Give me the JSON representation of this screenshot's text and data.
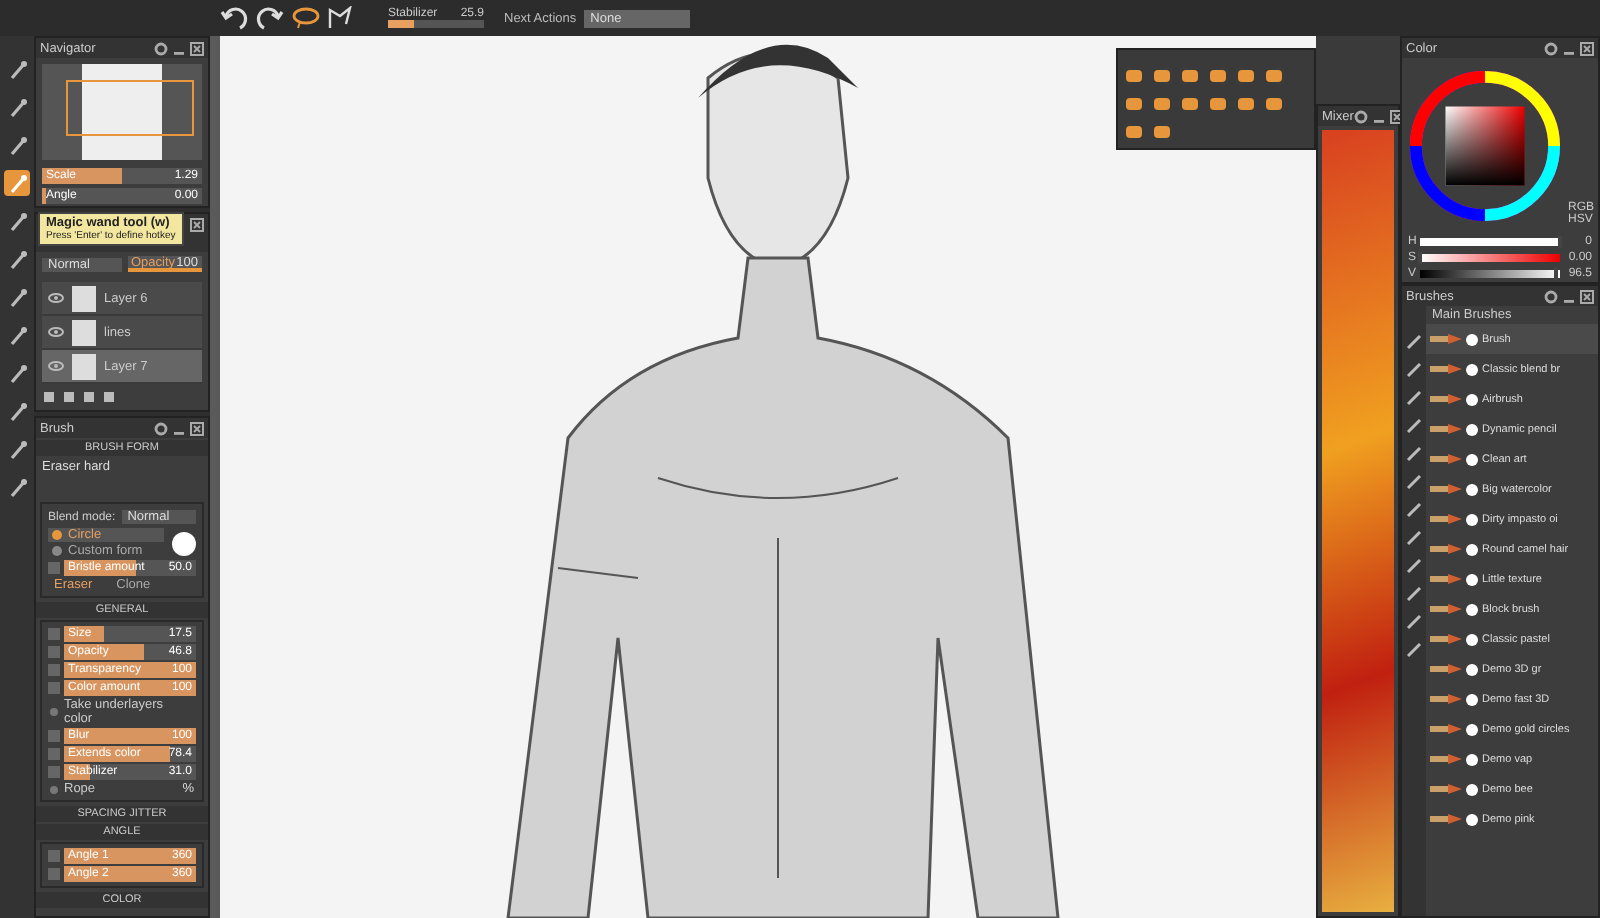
{
  "top_bar": {
    "stabilizer": {
      "label": "Stabilizer",
      "reading": "25.9",
      "level": 0.28
    },
    "next_action": {
      "label": "Next Actions",
      "value": "None"
    }
  },
  "tools": [
    {
      "selected": false
    },
    {
      "selected": false
    },
    {
      "selected": false
    },
    {
      "selected": true
    },
    {
      "selected": false
    },
    {
      "selected": false
    },
    {
      "selected": false
    },
    {
      "selected": false
    },
    {
      "selected": false
    },
    {
      "selected": false
    },
    {
      "selected": false
    },
    {
      "selected": false
    }
  ],
  "tooltip": {
    "title": "Magic wand tool (w)",
    "hint": "Press 'Enter' to define hotkey"
  },
  "navigator": {
    "title": "Navigator",
    "sliders": [
      {
        "label": "Scale",
        "reading": "1.29",
        "level": 0.5
      },
      {
        "label": "Angle",
        "reading": "0.00",
        "level": 0.0
      }
    ]
  },
  "layers": {
    "blend": "Normal",
    "opacity": {
      "label": "Opacity",
      "reading": "100",
      "level": 1
    },
    "items": [
      {
        "name": "Layer 6",
        "selected": false
      },
      {
        "name": "lines",
        "selected": false
      },
      {
        "name": "Layer 7",
        "selected": true
      }
    ]
  },
  "brush": {
    "title": "Brush",
    "section": "BRUSH FORM",
    "preset": "Eraser hard",
    "blend_label": "Blend mode:",
    "blend": "Normal",
    "forms": [
      {
        "label": "Circle",
        "selected": true
      },
      {
        "label": "Custom form",
        "selected": false
      }
    ],
    "bristle": {
      "label": "Bristle amount",
      "reading": "50.0",
      "level": 0.55
    },
    "modes": [
      {
        "label": "Eraser",
        "selected": true
      },
      {
        "label": "Clone",
        "selected": false
      }
    ],
    "general": {
      "title": "GENERAL",
      "rows": [
        {
          "kind": "slider",
          "label": "Size",
          "reading": "17.5",
          "level": 0.3
        },
        {
          "kind": "slider",
          "label": "Opacity",
          "reading": "46.8",
          "level": 0.6
        },
        {
          "kind": "slider",
          "label": "Transparency",
          "reading": "100",
          "level": 1
        },
        {
          "kind": "slider",
          "label": "Color amount",
          "reading": "100",
          "level": 1
        },
        {
          "kind": "checkbox",
          "label": "Take underlayers color",
          "checked": false
        },
        {
          "kind": "slider",
          "label": "Blur",
          "reading": "100",
          "level": 1
        },
        {
          "kind": "slider",
          "label": "Extends color",
          "reading": "78.4",
          "level": 0.8
        },
        {
          "kind": "slider",
          "label": "Stabilizer",
          "reading": "31.0",
          "level": 0.2
        },
        {
          "kind": "checkbox",
          "label": "Rope",
          "checked": false,
          "reading": "%"
        }
      ]
    },
    "spacing": {
      "title": "SPACING JITTER"
    },
    "angle": {
      "title": "ANGLE",
      "rows": [
        {
          "label": "Angle 1",
          "reading": "360",
          "level": 1
        },
        {
          "label": "Angle 2",
          "reading": "360",
          "level": 1
        }
      ]
    },
    "color": {
      "title": "COLOR"
    }
  },
  "mixer": {
    "title": "Mixer"
  },
  "color_panel": {
    "title": "Color",
    "models": [
      "RGB",
      "HSV"
    ],
    "channels": [
      {
        "label": "H",
        "reading": "0",
        "level": 1
      },
      {
        "label": "S",
        "reading": "0.00",
        "level": 0
      },
      {
        "label": "V",
        "reading": "96.5",
        "level": 0.965
      }
    ]
  },
  "brushes": {
    "title": "Brushes",
    "group": "Main Brushes",
    "items": [
      {
        "name": "Brush",
        "selected": true
      },
      {
        "name": "Classic blend br",
        "selected": false
      },
      {
        "name": "Airbrush",
        "selected": false
      },
      {
        "name": "Dynamic pencil",
        "selected": false
      },
      {
        "name": "Clean art",
        "selected": false
      },
      {
        "name": "Big watercolor",
        "selected": false
      },
      {
        "name": "Dirty impasto oi",
        "selected": false
      },
      {
        "name": "Round camel hair",
        "selected": false
      },
      {
        "name": "Little texture",
        "selected": false
      },
      {
        "name": "Block brush",
        "selected": false
      },
      {
        "name": "Classic pastel",
        "selected": false
      },
      {
        "name": "Demo 3D gr",
        "selected": false
      },
      {
        "name": "Demo fast 3D",
        "selected": false
      },
      {
        "name": "Demo gold circles",
        "selected": false
      },
      {
        "name": "Demo vap",
        "selected": false
      },
      {
        "name": "Demo bee",
        "selected": false
      },
      {
        "name": "Demo pink",
        "selected": false
      }
    ]
  }
}
